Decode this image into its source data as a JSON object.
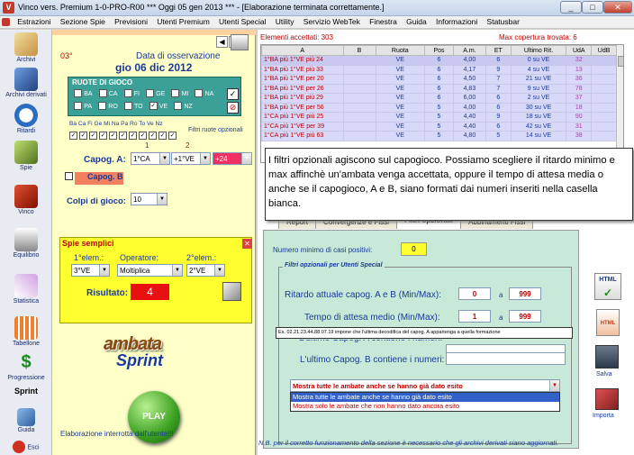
{
  "window": {
    "title": "Vinco vers. Premium  1-0-PRO-R00  ***  Oggi 05 gen 2013  ***  - [Elaborazione terminata correttamente.]",
    "min": "_",
    "max": "□",
    "close": "✕"
  },
  "menu": [
    "Estrazioni",
    "Sezione Spie",
    "Previsioni",
    "Utenti Premium",
    "Utenti Special",
    "Utility",
    "Servizio WebTek",
    "Finestra",
    "Guida",
    "Informazioni",
    "Statusbar"
  ],
  "sidebar": [
    {
      "label": "Archivi",
      "icon": "pencil-icon"
    },
    {
      "label": "Archivi derivati",
      "icon": "book-icon"
    },
    {
      "label": "Ritardi",
      "icon": "clock-icon"
    },
    {
      "label": "Spie",
      "icon": "binoculars-icon"
    },
    {
      "label": "Vinco",
      "icon": "v-logo-icon"
    },
    {
      "label": "Equilibrio",
      "icon": "scale-icon"
    },
    {
      "label": "Statistica",
      "icon": "chart-icon"
    },
    {
      "label": "Tabellone",
      "icon": "grid-icon"
    },
    {
      "label": "Progressione",
      "icon": "dollar-icon"
    },
    {
      "label": "Sprint",
      "icon": "sprint-icon"
    },
    {
      "label": "Guida",
      "icon": "guide-icon"
    },
    {
      "label": "Esci",
      "icon": "exit-icon"
    }
  ],
  "left": {
    "degree": "03°",
    "obs_label": "Data di osservazione",
    "obs_date": "gio 06 dic 2012",
    "wheels_title": "RUOTE DI GIOCO",
    "wheels_row1": [
      "BA",
      "CA",
      "FI",
      "GE",
      "MI",
      "NA"
    ],
    "wheels_row2": [
      "PA",
      "RO",
      "TO",
      "VE",
      "NZ"
    ],
    "wheel_header": "Ba Ca Fi Ge Mi Na Pa Ro To Ve Nz",
    "filter_label": "Filtri ruote opzionali",
    "col1": "1",
    "col2": "2",
    "capoA_label": "Capog. A:",
    "capoA_1": "1°CA",
    "capoA_2": "+1°VE",
    "capoA_3": "+24",
    "capoB_label": "Capog. B",
    "colpi_label": "Colpi di gioco:",
    "colpi_value": "10",
    "spie_title": "Spie semplici",
    "elem1_label": "1°elem.:",
    "operator_label": "Operatore:",
    "elem2_label": "2°elem.:",
    "elem1_value": "3°VE",
    "operator_value": "Moltiplica",
    "elem2_value": "2°VE",
    "result_label": "Risultato:",
    "result_value": "4",
    "logo_line1": "ambata",
    "logo_line2": "Sprint",
    "play_label": "PLAY",
    "status": "Elaborazione interrotta dall'utente!!!"
  },
  "right": {
    "accepted": "Elementi accettati: 303",
    "max_cov": "Max copertura trovata:  6",
    "columns": [
      "A",
      "B",
      "Ruota",
      "Pos",
      "A.m.",
      "ET",
      "Ultimo Rit.",
      "UdA",
      "UdB"
    ],
    "rows": [
      [
        "1°BA più  1°VE  più 24",
        "",
        "VE",
        "6",
        "4,00",
        "6",
        "0 su VE",
        "32",
        ""
      ],
      [
        "1°BA più  1°VE  più 33",
        "",
        "VE",
        "6",
        "4,17",
        "9",
        "4 su VE",
        "13",
        ""
      ],
      [
        "1°BA più  1°VE  per 20",
        "",
        "VE",
        "6",
        "4,50",
        "7",
        "21 su VE",
        "36",
        ""
      ],
      [
        "1°BA più  1°VE  per 26",
        "",
        "VE",
        "6",
        "4,83",
        "7",
        "9 su VE",
        "78",
        ""
      ],
      [
        "1°BA più  1°VE  più 29",
        "",
        "VE",
        "6",
        "6,00",
        "6",
        "2 su VE",
        "37",
        ""
      ],
      [
        "1°BA più  1°VE  per 56",
        "",
        "VE",
        "5",
        "4,00",
        "6",
        "30 su VE",
        "18",
        ""
      ],
      [
        "1°CA più  1°VE  più 25",
        "",
        "VE",
        "5",
        "4,40",
        "9",
        "18 su VE",
        "90",
        ""
      ],
      [
        "1°CA più  1°VE  per 39",
        "",
        "VE",
        "5",
        "4,40",
        "6",
        "42 su VE",
        "31",
        ""
      ],
      [
        "1°CA più  1°VE  più 63",
        "",
        "VE",
        "5",
        "4,80",
        "5",
        "14 su VE",
        "38",
        ""
      ]
    ],
    "tabs": [
      "Report",
      "Convergenze e Fissi",
      "Filtri opzionali",
      "Abbinamenti Fissi"
    ],
    "min_pos_label": "Numero minimo di casi positivi:",
    "min_pos_value": "0",
    "special_title": "Filtri opzionali per Utenti Special",
    "rit_label": "Ritardo attuale capog. A e B (Min/Max):",
    "rit_min": "0",
    "rit_a": "a",
    "rit_max": "999",
    "tm_label": "Tempo di attesa medio (Min/Max):",
    "tm_min": "1",
    "tm_a": "a",
    "tm_max": "999",
    "hint": "Es. 02.21.23.44.88.07.19 impone che l'ultima decodifica del capog. A appartenga a quella formazione",
    "capoB_label": "L'ultimo Capog. B contiene i numeri:",
    "capoA_partial": "L'ultimo Capog. A contiene i numeri:",
    "combo_value": "Mostra tutte le ambate anche se hanno già dato esito",
    "combo_options": [
      "Mostra tutte le ambate anche se hanno già dato esito",
      "Mostra solo le ambate che non hanno dato ancora esito"
    ],
    "note": "N.B. per il corretto funzionamento della sezione è necessario che gli archivi derivati siano aggiornati.",
    "side_btns": [
      {
        "label": "",
        "icon": "html-check-icon"
      },
      {
        "label": "",
        "icon": "html-doc-icon"
      },
      {
        "label": "Salva",
        "icon": "save-icon"
      },
      {
        "label": "Importa",
        "icon": "import-icon"
      }
    ]
  },
  "tooltip": "I filtri opzionali agiscono sul capogioco. Possiamo scegliere il ritardo minimo e max affinchè un'ambata venga accettata, oppure il tempo di attesa media o anche se il capogioco, A e B, siano formati dai numeri inseriti nella casella bianca."
}
